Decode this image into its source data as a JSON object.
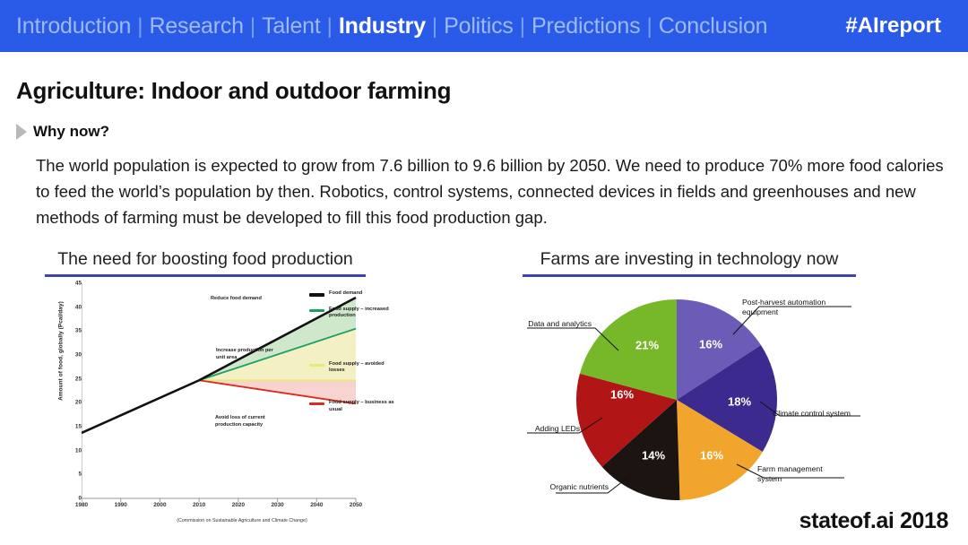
{
  "nav": {
    "items": [
      {
        "label": "Introduction",
        "active": false
      },
      {
        "label": "Research",
        "active": false
      },
      {
        "label": "Talent",
        "active": false
      },
      {
        "label": "Industry",
        "active": true
      },
      {
        "label": "Politics",
        "active": false
      },
      {
        "label": "Predictions",
        "active": false
      },
      {
        "label": "Conclusion",
        "active": false
      }
    ],
    "separator": "|",
    "hashtag": "#AIreport",
    "bar_color": "#2a5ae8"
  },
  "slide": {
    "title": "Agriculture: Indoor and outdoor farming",
    "why_label": "Why now?",
    "body": "The world population is expected to grow from 7.6 billion to 9.6 billion by 2050. We need to produce 70% more food calories to feed the world’s population by then. Robotics, control systems, connected devices in fields and greenhouses and new methods of farming must be developed to fill this food production gap.",
    "branding": "stateof.ai 2018",
    "accent_color": "#3b47a8"
  },
  "panels": {
    "left_heading": "The need for boosting food production",
    "right_heading": "Farms are investing in technology now"
  },
  "chart_data": [
    {
      "type": "line",
      "title": "The need for boosting food production",
      "xlabel": "",
      "ylabel": "Amount of food, globally (Pcal/day)",
      "caption": "(Commission on Sustainable Agriculture and Climate Change)",
      "xlim": [
        1980,
        2050
      ],
      "ylim": [
        0,
        45
      ],
      "xticks": [
        1980,
        1990,
        2000,
        2010,
        2020,
        2030,
        2040,
        2050
      ],
      "yticks": [
        0,
        5,
        10,
        15,
        20,
        25,
        30,
        35,
        40,
        45
      ],
      "grid": false,
      "legend_position": "right",
      "series": [
        {
          "name": "Food demand",
          "color": "#111111",
          "x": [
            1980,
            2010,
            2050
          ],
          "values": [
            13.7,
            24.7,
            42.0
          ]
        },
        {
          "name": "Food supply – increased production",
          "color": "#1f9e62",
          "x": [
            2010,
            2050
          ],
          "values": [
            24.7,
            35.5
          ]
        },
        {
          "name": "Food supply – avoided losses",
          "color": "#e9e97a",
          "x": [
            2010,
            2050
          ],
          "values": [
            24.7,
            24.7
          ]
        },
        {
          "name": "Food supply – business as usual",
          "color": "#d92b1c",
          "x": [
            2010,
            2050
          ],
          "values": [
            24.7,
            19.8
          ]
        }
      ],
      "annotations": [
        "Reduce food demand",
        "Increase production per unit area",
        "Avoid loss of current production capacity"
      ]
    },
    {
      "type": "pie",
      "title": "Farms are investing in technology now",
      "categories": [
        "Post-harvest automation equipment",
        "Climate control system",
        "Farm management system",
        "Organic nutrients",
        "Adding LEDs",
        "Data and analytics"
      ],
      "values": [
        16,
        18,
        16,
        14,
        16,
        21
      ],
      "value_labels": [
        "16%",
        "18%",
        "16%",
        "14%",
        "16%",
        "21%"
      ],
      "colors": [
        "#6c5cb8",
        "#3d2a8f",
        "#f2a52c",
        "#1c1410",
        "#b11515",
        "#76b82a"
      ],
      "legend_position": "callout-labels"
    }
  ]
}
